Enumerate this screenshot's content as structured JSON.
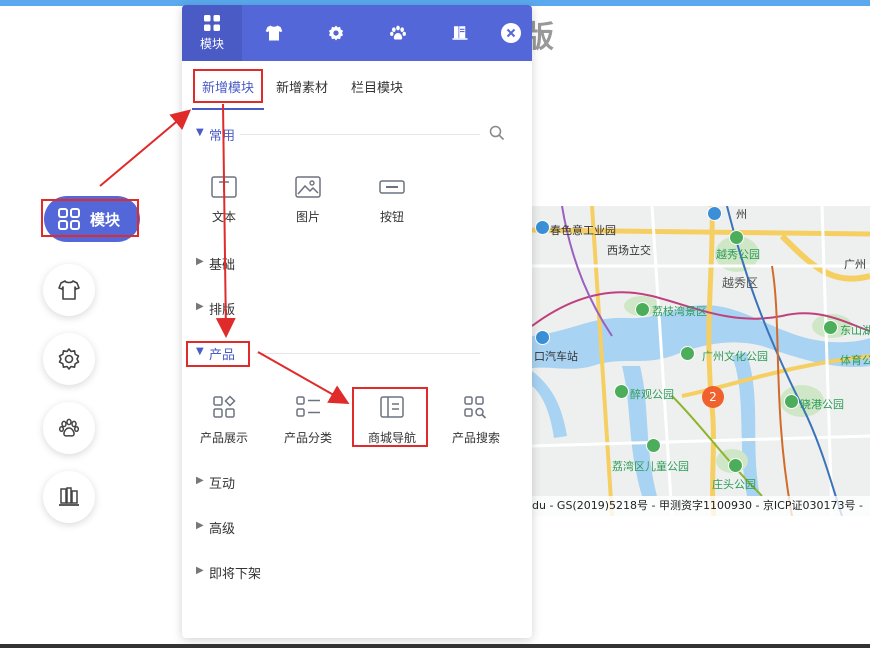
{
  "background": {
    "title_fragment": "版"
  },
  "map": {
    "labels": [
      {
        "text": "春色意工业园",
        "kind": "normal"
      },
      {
        "text": "西场立交",
        "kind": "normal"
      },
      {
        "text": "越秀公园",
        "kind": "green"
      },
      {
        "text": "越秀区",
        "kind": "district"
      },
      {
        "text": "荔枝湾景区",
        "kind": "green"
      },
      {
        "text": "东山湖",
        "kind": "green"
      },
      {
        "text": "口汽车站",
        "kind": "normal"
      },
      {
        "text": "广州文化公园",
        "kind": "green"
      },
      {
        "text": "体育公",
        "kind": "green"
      },
      {
        "text": "醉观公园",
        "kind": "green"
      },
      {
        "text": "晓港公园",
        "kind": "green"
      },
      {
        "text": "荔湾区儿童公园",
        "kind": "green"
      },
      {
        "text": "庄头公园",
        "kind": "green"
      },
      {
        "text": "州",
        "kind": "normal"
      },
      {
        "text": "广州",
        "kind": "normal"
      }
    ],
    "cluster_count": "2",
    "copyright": "du - GS(2019)5218号 - 甲测资字1100930 - 京ICP证030173号 -"
  },
  "dock": {
    "active_label": "模块",
    "items": [
      "module-icon",
      "shirt-icon",
      "gear-icon",
      "paw-icon",
      "books-icon"
    ]
  },
  "panel": {
    "header_tabs": [
      {
        "label": "模块",
        "icon": "grid-icon"
      },
      {
        "label": "",
        "icon": "shirt-icon"
      },
      {
        "label": "",
        "icon": "gear-icon"
      },
      {
        "label": "",
        "icon": "paw-icon"
      },
      {
        "label": "",
        "icon": "books-icon"
      }
    ],
    "sub_tabs": [
      "新增模块",
      "新增素材",
      "栏目模块"
    ],
    "sections": {
      "common": {
        "title": "常用",
        "items": [
          "文本",
          "图片",
          "按钮"
        ]
      },
      "basic": {
        "title": "基础"
      },
      "layout": {
        "title": "排版"
      },
      "product": {
        "title": "产品",
        "items": [
          "产品展示",
          "产品分类",
          "商城导航",
          "产品搜索"
        ]
      },
      "interact": {
        "title": "互动"
      },
      "advanced": {
        "title": "高级"
      },
      "offline": {
        "title": "即将下架"
      }
    }
  },
  "colors": {
    "accent": "#5367d8",
    "highlight": "#e02b2b",
    "map_green": "#4cae5b",
    "map_cluster": "#f0612e"
  }
}
